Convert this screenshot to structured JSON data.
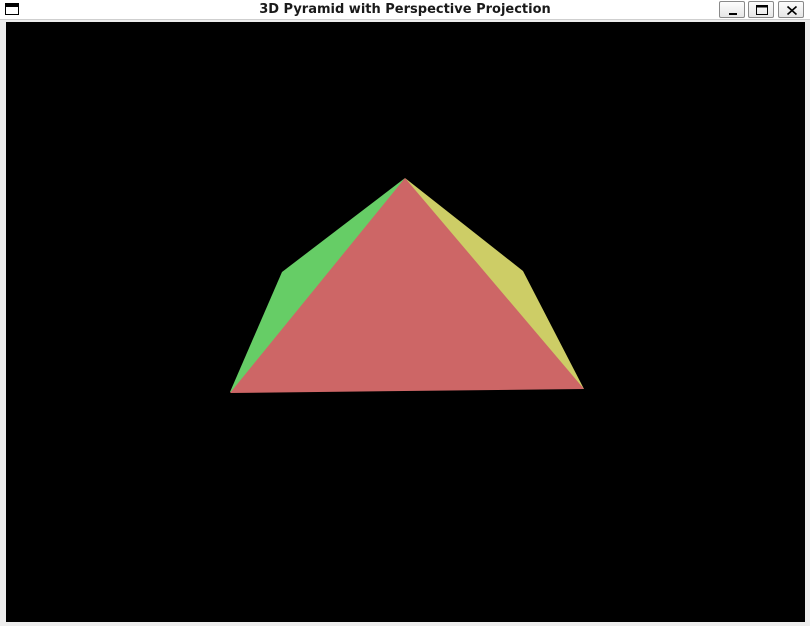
{
  "window": {
    "title": "3D Pyramid with Perspective Projection",
    "icons": {
      "app": "window-icon",
      "minimize": "minimize-icon",
      "maximize": "maximize-icon",
      "close": "close-icon"
    }
  },
  "scene": {
    "background": "#000000",
    "faces": [
      {
        "name": "front-face",
        "color": "#cd6666"
      },
      {
        "name": "left-face",
        "color": "#66cd66"
      },
      {
        "name": "right-face",
        "color": "#cdcd66"
      }
    ]
  }
}
